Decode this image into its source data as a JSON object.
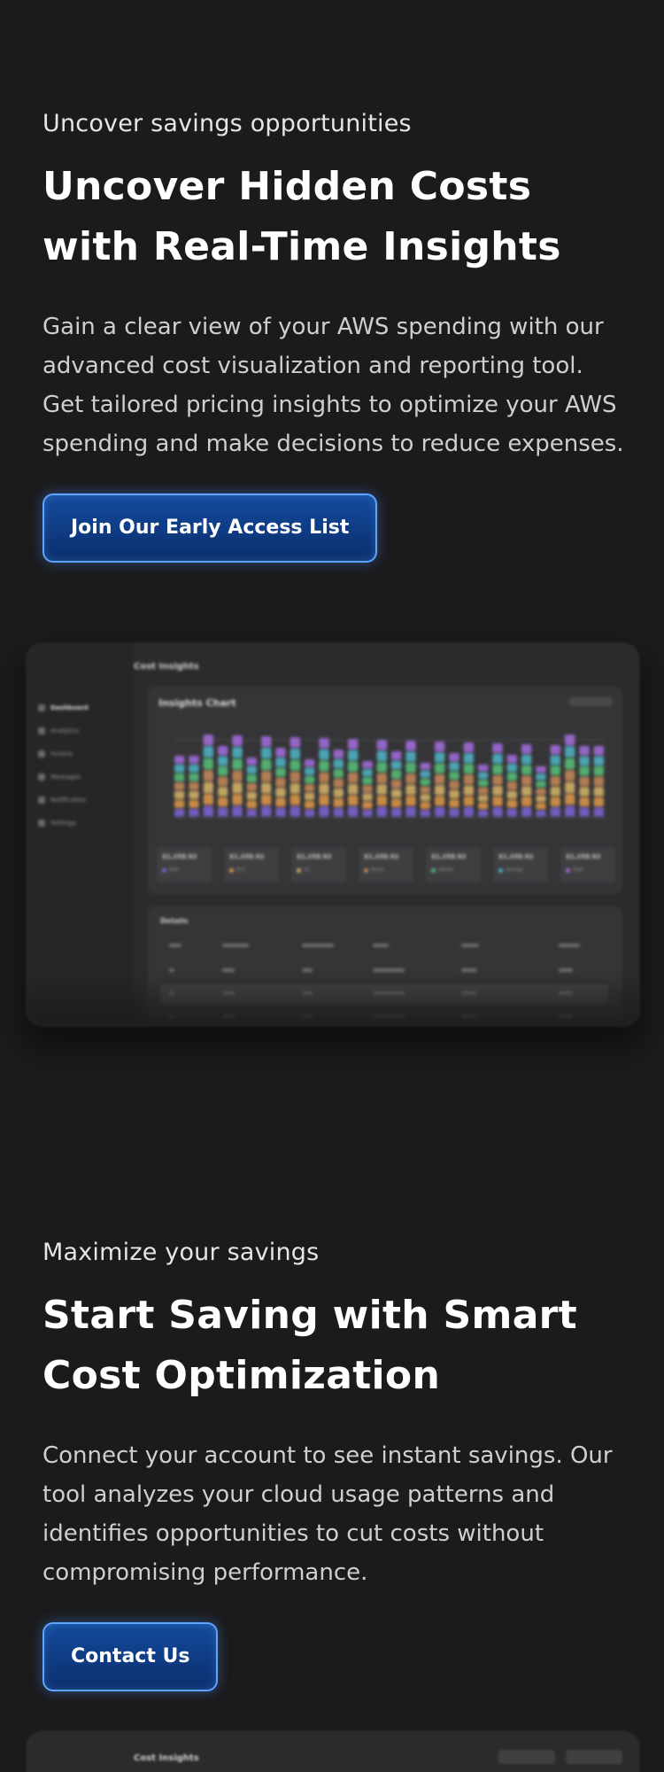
{
  "hero": {
    "eyebrow": "Uncover savings opportunities",
    "headline": "Uncover Hidden Costs with Real-Time Insights",
    "body": "Gain a clear view of your AWS spending with our advanced cost visualization and reporting tool. Get tailored pricing insights to optimize your AWS spending and make decisions to reduce expenses.",
    "cta_label": "Join Our Early Access List"
  },
  "savings": {
    "eyebrow": "Maximize your savings",
    "headline": "Start Saving with Smart Cost Optimization",
    "body": "Connect your account to see instant savings. Our tool analyzes your cloud usage patterns and identifies opportunities to cut costs without compromising performance.",
    "cta_label": "Contact Us"
  },
  "colors": {
    "background": "#1b1b1c",
    "cta_fill": "#0f3d86",
    "cta_border": "#5fa4ff",
    "series": [
      "#7e63d6",
      "#e09a4a",
      "#d8b56a",
      "#c88a5a",
      "#57c27a",
      "#4fb6c9",
      "#a56de0"
    ]
  },
  "mockup": {
    "title": "Cost Insights",
    "chart_title": "Insights Chart",
    "nav": [
      {
        "label": "Dashboard",
        "active": true
      },
      {
        "label": "Analytics",
        "active": false
      },
      {
        "label": "Invoice",
        "active": false
      },
      {
        "label": "Messages",
        "active": false
      },
      {
        "label": "Notification",
        "active": false
      },
      {
        "label": "Settings",
        "active": false
      }
    ],
    "stats": [
      {
        "value": "$1,258.92",
        "label": "RDS"
      },
      {
        "value": "$1,258.92",
        "label": "EC2"
      },
      {
        "value": "$1,258.92",
        "label": "S3"
      },
      {
        "value": "$1,258.92",
        "label": "Route"
      },
      {
        "value": "$1,258.92",
        "label": "Others"
      },
      {
        "value": "$1,258.92",
        "label": "Savings"
      },
      {
        "value": "$1,258.92",
        "label": "Total"
      }
    ],
    "details_title": "Details"
  },
  "mockup2": {
    "title": "Cost Insights"
  }
}
